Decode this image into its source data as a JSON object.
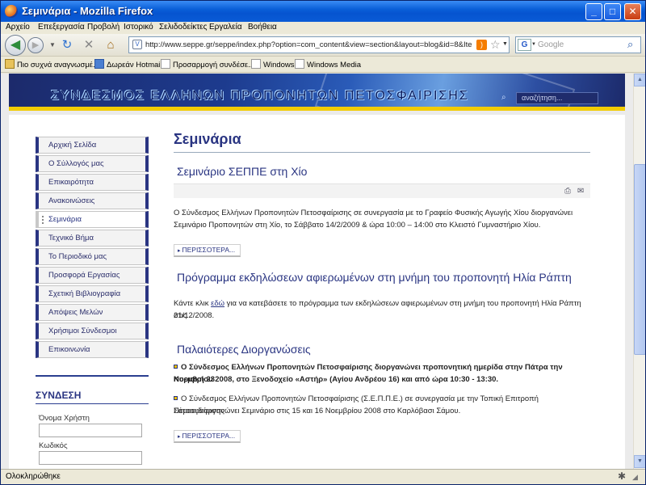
{
  "window": {
    "title": "Σεμινάρια - Mozilla Firefox"
  },
  "menu": [
    "Αρχείο",
    "Επεξεργασία",
    "Προβολή",
    "Ιστορικό",
    "Σελιδοδείκτες",
    "Εργαλεία",
    "Βοήθεια"
  ],
  "toolbar": {
    "url": "http://www.seppe.gr/seppe/index.php?option=com_content&view=section&layout=blog&id=8&Itemid=72",
    "search_placeholder": "Google"
  },
  "bookmarks": [
    "Πιο συχνά αναγνωσμέ...",
    "Δωρεάν Hotmail",
    "Προσαρμογή συνδέσε...",
    "Windows",
    "Windows Media"
  ],
  "site": {
    "title": "ΣΥΝΔΕΣΜΟΣ ΕΛΛΗΝΩΝ ΠΡΟΠΟΝΗΤΩΝ ΠΕΤΟΣΦΑΙΡΙΣΗΣ",
    "search_placeholder": "αναζήτηση..."
  },
  "sidebar": {
    "items": [
      {
        "label": "Αρχική Σελίδα",
        "active": false
      },
      {
        "label": "Ο Σύλλογός μας",
        "active": false
      },
      {
        "label": "Επικαιρότητα",
        "active": false
      },
      {
        "label": "Ανακοινώσεις",
        "active": false
      },
      {
        "label": "Σεμινάρια",
        "active": true
      },
      {
        "label": "Τεχνικό Βήμα",
        "active": false
      },
      {
        "label": "Το Περιοδικό μας",
        "active": false
      },
      {
        "label": "Προσφορά Εργασίας",
        "active": false
      },
      {
        "label": "Σχετική Βιβλιογραφία",
        "active": false
      },
      {
        "label": "Απόψεις Μελών",
        "active": false
      },
      {
        "label": "Χρήσιμοι Σύνδεσμοι",
        "active": false
      },
      {
        "label": "Επικοινωνία",
        "active": false
      }
    ]
  },
  "login": {
    "title": "ΣΥΝΔΕΣΗ",
    "username_label": "Όνομα Χρήστη",
    "password_label": "Κωδικός"
  },
  "main": {
    "page_title": "Σεμινάρια",
    "article1": {
      "title": "Σεμινάριο ΣΕΠΠΕ στη Χίο",
      "line1": "Ο Σύνδεσμος Ελλήνων Προπονητών Πετοσφαίρισης σε συνεργασία με το Γραφείο Φυσικής Αγωγής Χίου διοργανώνει",
      "line2": "Σεμινάριο Προπονητών στη Χίο, το Σάββατο 14/2/2009 & ώρα 10:00 – 14:00 στο Κλειστό Γυμναστήριο Χίου.",
      "more": "ΠΕΡΙΣΣΟΤΕΡΑ..."
    },
    "article2": {
      "title": "Πρόγραμμα εκδηλώσεων αφιερωμένων στη μνήμη του προπονητή Ηλία Ράπτη",
      "pre": "Κάντε κλικ ",
      "link": "εδώ",
      "post": " για να κατεβάσετε το πρόγραμμα των εκδηλώσεων αφιερωμένων στη μνήμη του προπονητή Ηλία Ράπτη στις",
      "line2": "21/12/2008."
    },
    "article3": {
      "title": "Παλαιότερες Διοργανώσεις",
      "b1_line1": "Ο Σύνδεσμος Ελλήνων Προπονητών Πετοσφαίρισης διοργανώνει προπονητική ημερίδα στην Πάτρα την Κυριακή 23",
      "b1_line2": "Νοεμβρίου 2008, στο Ξενοδοχείο «Αστήρ» (Αγίου Ανδρέου 16) και από ώρα 10:30 - 13:30.",
      "b2_line1": "Ο Σύνδεσμος Ελλήνων Προπονητών Πετοσφαίρισης (Σ.Ε.Π.Π.Ε.) σε συνεργασία με την Τοπική Επιτροπή Πετοσφαίρισης",
      "b2_line2": "Σάμου διοργανώνει Σεμινάριο στις 15 και 16 Νοεμβρίου 2008 στο Καρλόβασι Σάμου.",
      "more": "ΠΕΡΙΣΣΟΤΕΡΑ..."
    }
  },
  "status": {
    "text": "Ολοκληρώθηκε"
  }
}
